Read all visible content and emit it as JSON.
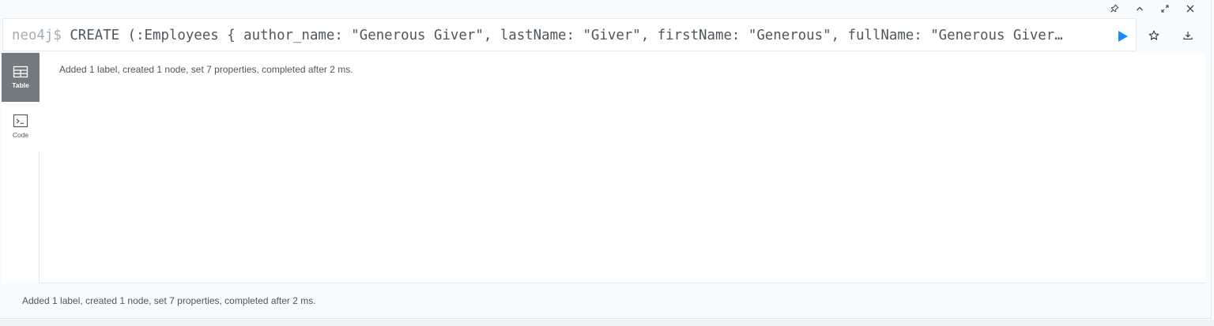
{
  "frame_controls": {
    "pin_icon": "pin-icon",
    "collapse_icon": "chevron-up-icon",
    "fullscreen_icon": "expand-icon",
    "close_icon": "close-icon"
  },
  "editor": {
    "prompt": "neo4j$",
    "query": "CREATE (:Employees { author_name: \"Generous Giver\", lastName: \"Giver\", firstName: \"Generous\", fullName: \"Generous Giver…",
    "run_icon": "play-icon",
    "favorite_icon": "star-icon",
    "download_icon": "download-icon",
    "accent_color": "#1a8cff"
  },
  "result": {
    "tabs": [
      {
        "label": "Table",
        "icon": "table-icon",
        "active": true
      },
      {
        "label": "Code",
        "icon": "terminal-icon",
        "active": false
      }
    ],
    "message": "Added 1 label, created 1 node, set 7 properties, completed after 2 ms."
  },
  "status": {
    "message": "Added 1 label, created 1 node, set 7 properties, completed after 2 ms."
  }
}
